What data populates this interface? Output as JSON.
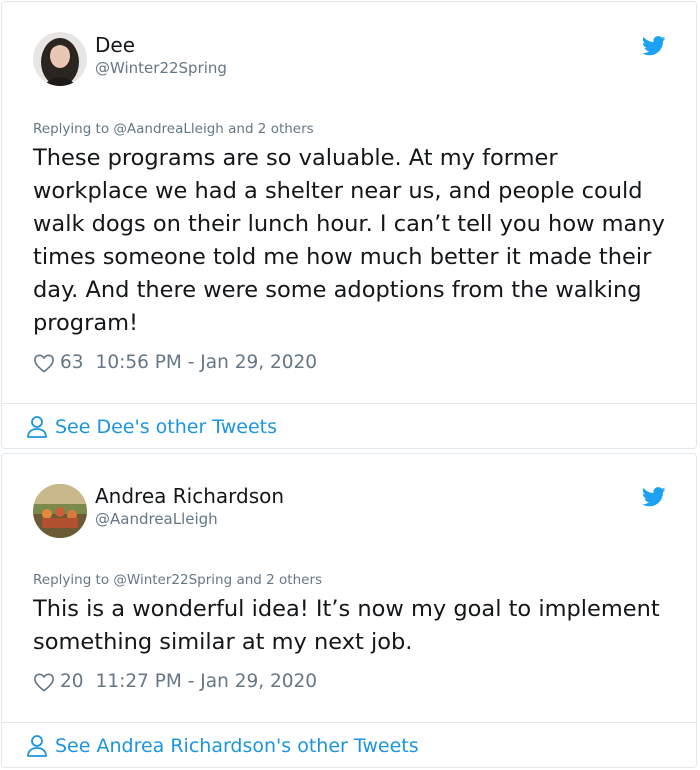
{
  "tweets": [
    {
      "name": "Dee",
      "handle": "@Winter22Spring",
      "reply_prefix": "Replying to ",
      "reply_mention": "@AandreaLleigh",
      "reply_suffix": " and 2 others",
      "text": "These programs are so valuable.  At my former workplace we had a shelter near us, and people could walk dogs on their lunch hour.  I can’t tell you how many times someone told me how much better it made their day. And there were some adoptions from the walking program!",
      "likes": "63",
      "timestamp": "10:56 PM - Jan 29, 2020",
      "see_more": "See Dee's other Tweets",
      "avatar_icon": "profile-photo",
      "colors": {
        "avatar_bg": "#3a3530"
      }
    },
    {
      "name": "Andrea Richardson",
      "handle": "@AandreaLleigh",
      "reply_prefix": "Replying to ",
      "reply_mention": "@Winter22Spring",
      "reply_suffix": " and 2 others",
      "text": "This is a wonderful idea! It’s now my goal to implement something similar at my next job.",
      "likes": "20",
      "timestamp": "11:27 PM - Jan 29, 2020",
      "see_more": "See Andrea Richardson's other Tweets",
      "avatar_icon": "profile-photo",
      "colors": {
        "avatar_bg": "#5a6a3a"
      }
    }
  ],
  "icons": {
    "brand": "twitter-bird-icon",
    "like": "heart-icon",
    "profile": "person-icon"
  },
  "colors": {
    "accent": "#1b95e0",
    "text": "#14171a",
    "muted": "#657786",
    "border": "#e1e8ed",
    "bird": "#1da1f2"
  }
}
